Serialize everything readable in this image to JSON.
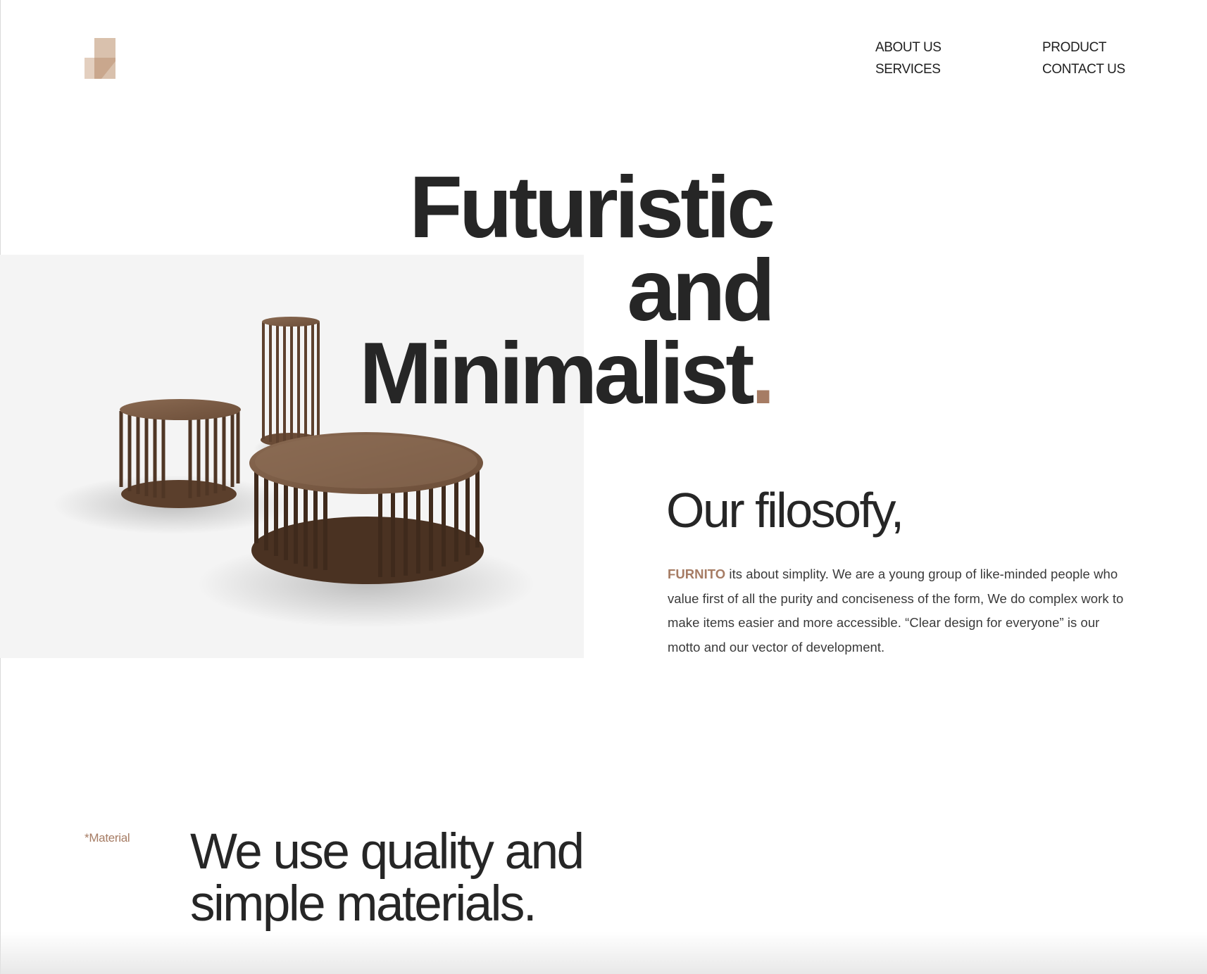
{
  "colors": {
    "accent": "#a67c64",
    "text": "#262626",
    "panel": "#f4f4f4",
    "wood": "#6b4a33"
  },
  "logo": {
    "icon": "folded-square-logo-icon"
  },
  "nav": {
    "about": "ABOUT US",
    "services": "SERVICES",
    "product": "PRODUCT",
    "contact": "CONTACT US"
  },
  "hero": {
    "line1": "Futuristic",
    "line2": "and",
    "line3": "Minimalist",
    "dot": ".",
    "image": "round-slatted-wooden-tables-image"
  },
  "filosofy": {
    "title": "Our filosofy,",
    "brand": "FURNITO",
    "body": " its about simplity. We are a young group of like-minded people who value first of all the purity and conciseness of the form, We do complex work to make items easier and more accessible. “Clear design for everyone” is our motto and our vector of development."
  },
  "material": {
    "tag": "*Material",
    "title": "We use quality and simple materials."
  }
}
